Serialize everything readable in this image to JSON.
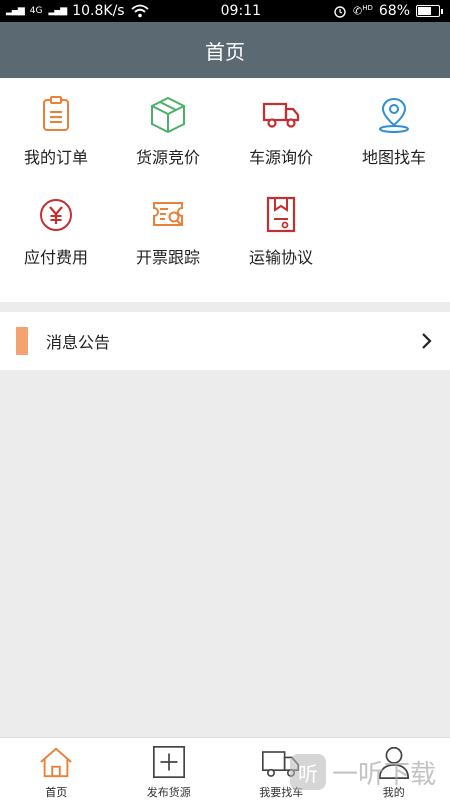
{
  "status_bar": {
    "signal_left": "4G",
    "network_speed": "10.8K/s",
    "time": "09:11",
    "hd_label": "HD",
    "battery_percent": "68%",
    "battery_level": 0.68
  },
  "header": {
    "title": "首页"
  },
  "grid": {
    "items": [
      {
        "label": "我的订单",
        "icon": "clipboard-icon",
        "color": "#e8823a"
      },
      {
        "label": "货源竞价",
        "icon": "package-box-icon",
        "color": "#4caf6b"
      },
      {
        "label": "车源询价",
        "icon": "truck-icon",
        "color": "#c62f2f"
      },
      {
        "label": "地图找车",
        "icon": "map-pin-icon",
        "color": "#2f8fd1"
      },
      {
        "label": "应付费用",
        "icon": "yuan-coin-icon",
        "color": "#c62f2f"
      },
      {
        "label": "开票跟踪",
        "icon": "invoice-track-icon",
        "color": "#e8823a"
      },
      {
        "label": "运输协议",
        "icon": "contract-doc-icon",
        "color": "#c62f2f"
      }
    ]
  },
  "notice": {
    "title": "消息公告"
  },
  "tabbar": {
    "tabs": [
      {
        "label": "首页",
        "icon": "home-icon",
        "active": true
      },
      {
        "label": "发布货源",
        "icon": "add-square-icon",
        "active": false
      },
      {
        "label": "我要找车",
        "icon": "truck-icon",
        "active": false
      },
      {
        "label": "我的",
        "icon": "user-icon",
        "active": false
      }
    ]
  },
  "watermark": {
    "badge": "听",
    "text": "一听下载"
  }
}
